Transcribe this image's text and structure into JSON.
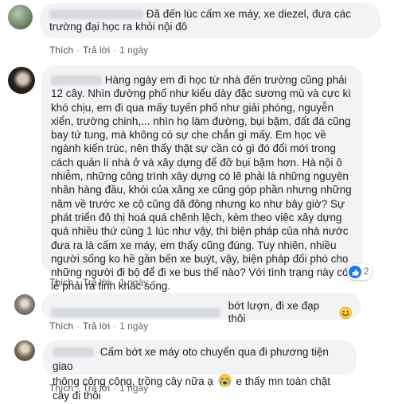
{
  "comments": [
    {
      "text": "Đã đến lúc cấm xe máy, xe diezel, đưa các trường đại học ra khỏi nội đô",
      "actions": {
        "like": "Thích",
        "reply": "Trả lời",
        "time": "1 ngày"
      }
    },
    {
      "text": "Hàng ngày em đi học từ nhà đến trường cũng phải 12 cây. Nhìn đường phố như kiểu dày đặc sương mù và cực kì khó chịu, em đi qua mấy tuyến phố như giải phóng, nguyễn xiển, trường chinh,... nhìn họ làm đường, bụi bặm, đất đá cũng bay tứ tung, mà không có sự che chắn gì mấy. Em học về ngành kiến trúc, nên thấy thật sự cần có gì đó đổi mới trong cách quản lí nhà ở và xây dựng để đỡ bụi bặm hơn. Hà nội ô nhiễm, những công trình xây dựng có lẽ phải là những nguyên nhân hàng đầu, khói của xăng xe cũng góp phần nhưng những năm về trước xe cộ cũng đã đông nhưng ko như bây giờ? Sự phát triển đô thị hoá quá chênh lệch, kèm theo việc xây dựng quá nhiều thứ cùng 1 lúc như vậy, thì biện pháp của nhà nước đưa ra là cấm xe máy, em thấy cũng đúng. Tuy nhiên, nhiều người sống ko hề gần bến xe buýt, vậy, biện pháp đối phó cho những người đi bộ để đi xe bus thế nào? Với tình trạng này có lẽ phải ra tỉnh khác sống.",
      "reaction_count": "2",
      "actions": {
        "like": "Thích",
        "reply": "Trả lời",
        "time": "1 ngày"
      }
    },
    {
      "text": "bớt lượn, đi xe đạp thôi",
      "actions": {
        "like": "Thích",
        "reply": "Trả lời",
        "time": "1 ngày"
      }
    },
    {
      "text_line1": "Cấm bớt xe máy oto chuyển qua đi phương tiện giao",
      "text_line2a": "thông công cộng, trồng cây nữa ạ",
      "text_line2b": "e thấy mn toàn chặt cây đi thôi",
      "actions": {
        "like": "Thích",
        "reply": "Trả lời",
        "time": "1 ngày"
      }
    }
  ]
}
